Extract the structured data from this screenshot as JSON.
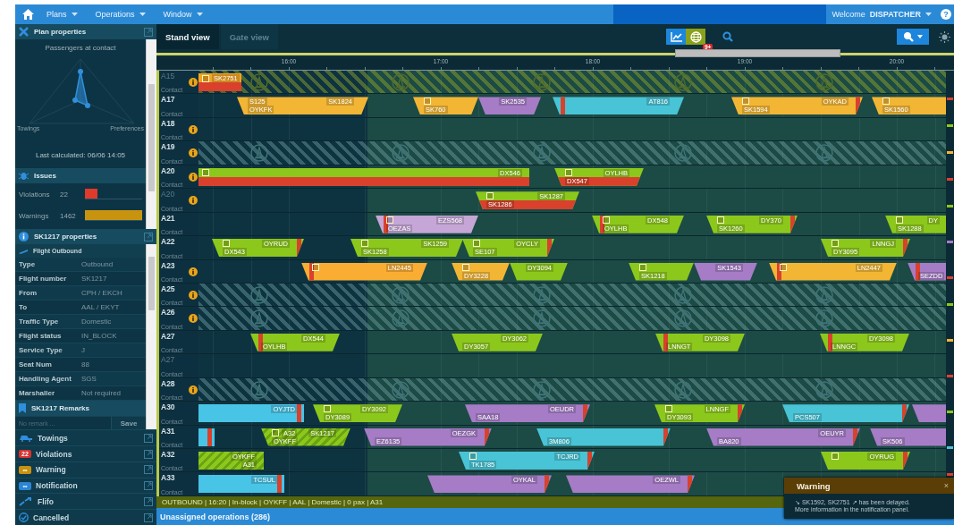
{
  "nav": {
    "menus": [
      "Plans",
      "Operations",
      "Window"
    ],
    "welcome": "Welcome **DISPATCHER**",
    "help": "?"
  },
  "plan_properties": {
    "title": "Plan properties",
    "radar_title": "Passengers at contact",
    "radar_labels": [
      "Towings",
      "Preferences"
    ],
    "last_calculated": "Last calculated: 06/06 14:05"
  },
  "issues": {
    "title": "Issues",
    "items": [
      {
        "label": "Violations",
        "count": "22",
        "level": 0.22,
        "color": "#e03a2c"
      },
      {
        "label": "Warnings",
        "count": "1462",
        "level": 1,
        "color": "#c89410"
      }
    ]
  },
  "flight_properties": {
    "title": "SK1217 properties",
    "subtitle": "Flight Outbound",
    "rows": [
      {
        "key": "Type",
        "value": "Outbound"
      },
      {
        "key": "Flight number",
        "value": "SK1217"
      },
      {
        "key": "From",
        "value": "CPH / EKCH"
      },
      {
        "key": "To",
        "value": "AAL / EKYT"
      },
      {
        "key": "Traffic Type",
        "value": "Domestic"
      },
      {
        "key": "Flight status",
        "value": "IN_BLOCK"
      },
      {
        "key": "Service Type",
        "value": "J"
      },
      {
        "key": "Seat Num",
        "value": "88"
      },
      {
        "key": "Handling Agent",
        "value": "SGS"
      },
      {
        "key": "Marshaller",
        "value": "Not required"
      }
    ]
  },
  "remarks": {
    "title": "SK1217 Remarks",
    "placeholder": "No remark ...",
    "button": "Save"
  },
  "panels": [
    {
      "kind": "towings",
      "label": "Towings"
    },
    {
      "kind": "violations",
      "badge": "22",
      "label": "Violations"
    },
    {
      "kind": "warning",
      "badge": "∞",
      "label": "Warning"
    },
    {
      "kind": "notification",
      "badge": "∞",
      "label": "Notification"
    },
    {
      "kind": "flifo",
      "label": "Flifo"
    },
    {
      "kind": "cancelled",
      "label": "Cancelled"
    }
  ],
  "tabs": [
    {
      "label": "Stand view",
      "selected": true
    },
    {
      "label": "Gate view",
      "selected": false
    }
  ],
  "toolbar": {
    "badge": "9+"
  },
  "axis": [
    "16:00",
    "17:00",
    "18:00",
    "19:00",
    "20:00"
  ],
  "rows": [
    {
      "label": "A15",
      "sub": "Contact",
      "dimmed": true,
      "info": true,
      "kind": "blocked_olive",
      "bars": [
        {
          "kind": "split",
          "color": "#f2a424",
          "flag": true,
          "top_left": "SK2751"
        }
      ]
    },
    {
      "label": "A17",
      "sub": "Contact",
      "dimmed": false,
      "info": false,
      "kind": "open",
      "bars": [
        {
          "kind": "plain",
          "color": "#f2b634",
          "flag": false,
          "top_left": "S125",
          "bottom_left": "OYKFK",
          "top_right": "SK1824"
        },
        {
          "kind": "plain",
          "color": "#f2b634",
          "flag": true,
          "bottom_left": "SK760"
        },
        {
          "kind": "plain",
          "color": "#a67cc6",
          "flag": false,
          "top_right": "SK2535"
        },
        {
          "kind": "plain",
          "color": "#48c4d6",
          "flag": false,
          "delay_left": true,
          "top_right": "AT816"
        },
        {
          "kind": "plain",
          "color": "#f2b634",
          "flag": true,
          "delay_right": true,
          "bottom_left": "SK1594",
          "top_right": "OYKAD"
        },
        {
          "kind": "plain",
          "color": "#f2b634",
          "flag": true,
          "bottom_left": "SK1560"
        }
      ]
    },
    {
      "label": "A18",
      "sub": "Contact",
      "dimmed": false,
      "info": true,
      "kind": "open",
      "bars": []
    },
    {
      "label": "A19",
      "sub": "Contact",
      "dimmed": false,
      "info": true,
      "kind": "blocked_teal",
      "bars": []
    },
    {
      "label": "A20",
      "sub": "Contact",
      "dimmed": false,
      "info": true,
      "kind": "open",
      "bars": [
        {
          "kind": "split",
          "color": "#8cc81c",
          "flag": true,
          "top_right": "DX546"
        },
        {
          "kind": "split",
          "color": "#8cc81c",
          "flag": true,
          "top_right": "OYLHB",
          "bottom_left": "DX547"
        }
      ]
    },
    {
      "label": "A20",
      "sub": "Contact",
      "dimmed": true,
      "info": true,
      "kind": "open",
      "bars": [
        {
          "kind": "split",
          "color": "#8cc81c",
          "flag": true,
          "top_right": "SK1287",
          "bottom_left": "SK1286"
        }
      ]
    },
    {
      "label": "A21",
      "sub": "Contact",
      "dimmed": false,
      "info": false,
      "kind": "open",
      "bars": [
        {
          "kind": "plain",
          "color": "#c5a6d6",
          "flag": true,
          "delay_left": true,
          "top_right": "EZS568",
          "bottom_left": "OEZAS"
        },
        {
          "kind": "plain",
          "color": "#8cc81c",
          "flag": true,
          "delay_left": true,
          "top_right": "DX548",
          "bottom_left": "OYLHB"
        },
        {
          "kind": "plain",
          "color": "#8cc81c",
          "flag": true,
          "delay_right": true,
          "top_right": "DY370",
          "bottom_left": "SK1260"
        },
        {
          "kind": "plain",
          "color": "#8cc81c",
          "flag": true,
          "top_right": "DY",
          "bottom_left": "SK1288"
        }
      ]
    },
    {
      "label": "A22",
      "sub": "Contact",
      "dimmed": false,
      "info": false,
      "kind": "open",
      "bars": [
        {
          "kind": "plain",
          "color": "#8cc81c",
          "flag": true,
          "delay_right": true,
          "top_right": "OYRUD",
          "bottom_left": "DX543"
        },
        {
          "kind": "plain",
          "color": "#8cc81c",
          "flag": true,
          "top_right": "SK1259",
          "bottom_left": "SK1258"
        },
        {
          "kind": "plain",
          "color": "#8cc81c",
          "flag": true,
          "delay_right": true,
          "top_right": "OYCLY",
          "bottom_left": "SE107"
        },
        {
          "kind": "plain",
          "color": "#8cc81c",
          "flag": true,
          "delay_right": true,
          "top_right": "LNNGJ",
          "bottom_left": "DY3095"
        }
      ]
    },
    {
      "label": "A23",
      "sub": "Contact",
      "dimmed": false,
      "info": true,
      "kind": "open",
      "bars": [
        {
          "kind": "plain",
          "color": "#f9ad32",
          "flag": true,
          "delay_left": true,
          "top_right": "LN2445"
        },
        {
          "kind": "plain",
          "color": "#f2b634",
          "flag": true,
          "bottom_left": "DY3228"
        },
        {
          "kind": "plain",
          "color": "#8cc81c",
          "flag": false,
          "top_right": "DY3094"
        },
        {
          "kind": "plain",
          "color": "#8cc81c",
          "flag": true,
          "bottom_left": "SK1218"
        },
        {
          "kind": "plain",
          "color": "#a67cc6",
          "flag": false,
          "top_right": "SK1543"
        },
        {
          "kind": "plain",
          "color": "#f2b634",
          "flag": true,
          "delay_left": true,
          "top_right": "LN2447"
        },
        {
          "kind": "plain",
          "color": "#a67cc6",
          "flag": false,
          "delay_left": true,
          "bottom_left": "SEZDD"
        }
      ]
    },
    {
      "label": "A25",
      "sub": "Contact",
      "dimmed": false,
      "info": true,
      "kind": "blocked_teal",
      "bars": []
    },
    {
      "label": "A26",
      "sub": "Contact",
      "dimmed": false,
      "info": true,
      "kind": "blocked_teal",
      "bars": []
    },
    {
      "label": "A27",
      "sub": "Contact",
      "dimmed": false,
      "info": false,
      "kind": "open",
      "bars": [
        {
          "kind": "plain",
          "color": "#8cc81c",
          "flag": false,
          "delay_left": true,
          "top_right": "DX544",
          "bottom_left": "OYLHB"
        },
        {
          "kind": "plain",
          "color": "#8cc81c",
          "flag": false,
          "top_right": "DY3062",
          "bottom_left": "DY3057"
        },
        {
          "kind": "plain",
          "color": "#8cc81c",
          "flag": false,
          "delay_left": true,
          "top_right": "DY3098",
          "bottom_left": "LNNGT"
        },
        {
          "kind": "plain",
          "color": "#8cc81c",
          "flag": false,
          "delay_left": true,
          "top_right": "DY3098",
          "bottom_left": "LNNGC"
        }
      ]
    },
    {
      "label": "A27",
      "sub": "Contact",
      "dimmed": true,
      "info": false,
      "kind": "open",
      "bars": []
    },
    {
      "label": "A28",
      "sub": "Contact",
      "dimmed": false,
      "info": true,
      "kind": "blocked_teal",
      "bars": []
    },
    {
      "label": "A30",
      "sub": "Contact",
      "dimmed": false,
      "info": false,
      "kind": "open",
      "bars": [
        {
          "kind": "plain",
          "color": "#48c4e6",
          "flag": false,
          "delay_right": true,
          "top_right": "OYJTD"
        },
        {
          "kind": "plain",
          "color": "#8cc81c",
          "flag": true,
          "top_right": "DY3092",
          "bottom_left": "DY3089"
        },
        {
          "kind": "plain",
          "color": "#a67cc6",
          "flag": false,
          "delay_right": true,
          "top_right": "OEUDR",
          "bottom_left": "SAA18"
        },
        {
          "kind": "plain",
          "color": "#8cc81c",
          "flag": true,
          "delay_right": true,
          "top_right": "LNNGF",
          "bottom_left": "DY3093"
        },
        {
          "kind": "plain",
          "color": "#48c4d6",
          "flag": false,
          "delay_right": true,
          "bottom_left": "PCS507"
        },
        {
          "kind": "plain",
          "color": "#a67cc6",
          "flag": false
        }
      ]
    },
    {
      "label": "A31",
      "sub": "Contact",
      "dimmed": false,
      "info": false,
      "kind": "open",
      "bars": [
        {
          "kind": "plain",
          "color": "#48c4e6",
          "flag": false,
          "delay_right": true
        },
        {
          "kind": "hatched",
          "color": "#8cc81c",
          "flag": true,
          "top_left": "A32",
          "bottom_left": "OYKFF",
          "top_right": "SK1217"
        },
        {
          "kind": "plain",
          "color": "#a67cc6",
          "flag": false,
          "delay_right": true,
          "top_right": "OEZGK",
          "bottom_left": "EZ6135"
        },
        {
          "kind": "plain",
          "color": "#48c4d6",
          "flag": false,
          "delay_right": true,
          "bottom_left": "3M806"
        },
        {
          "kind": "plain",
          "color": "#a67cc6",
          "flag": false,
          "delay_right": true,
          "top_right": "OEUYR",
          "bottom_left": "BA820"
        },
        {
          "kind": "plain",
          "color": "#a67cc6",
          "flag": false,
          "bottom_left": "SK506"
        }
      ]
    },
    {
      "label": "A32",
      "sub": "Contact",
      "dimmed": false,
      "info": false,
      "kind": "open",
      "bars": [
        {
          "kind": "hatched",
          "color": "#8cc81c",
          "flag": false,
          "top_right": "OYKFF",
          "bottom_right": "A31"
        },
        {
          "kind": "plain",
          "color": "#48c4d6",
          "flag": true,
          "delay_right": true,
          "top_right": "TCJRD",
          "bottom_left": "TK1785"
        },
        {
          "kind": "plain",
          "color": "#8cc81c",
          "flag": true,
          "delay_right": true,
          "top_right": "OYRUG"
        }
      ]
    },
    {
      "label": "A33",
      "sub": "Contact",
      "dimmed": false,
      "info": false,
      "kind": "open",
      "bars": [
        {
          "kind": "plain",
          "color": "#48c4e6",
          "flag": false,
          "delay_right": true,
          "top_right": "TCSUL"
        },
        {
          "kind": "plain",
          "color": "#a67cc6",
          "flag": false,
          "delay_right": true,
          "top_right": "OYKAL"
        },
        {
          "kind": "plain",
          "color": "#a67cc6",
          "flag": false,
          "delay_right": true,
          "top_right": "OEZWL"
        }
      ]
    }
  ],
  "status_bar": "OUTBOUND | 16:20 | In-block | OYKFF | AAL | Domestic | 0 pax | A31",
  "unassigned": "Unassigned operations (286)",
  "warning": {
    "title": "Warning",
    "close": "×",
    "lines": [
      "↘ SK1592, SK2751 ↗ has been delayed.",
      "More information in the notification panel."
    ]
  }
}
